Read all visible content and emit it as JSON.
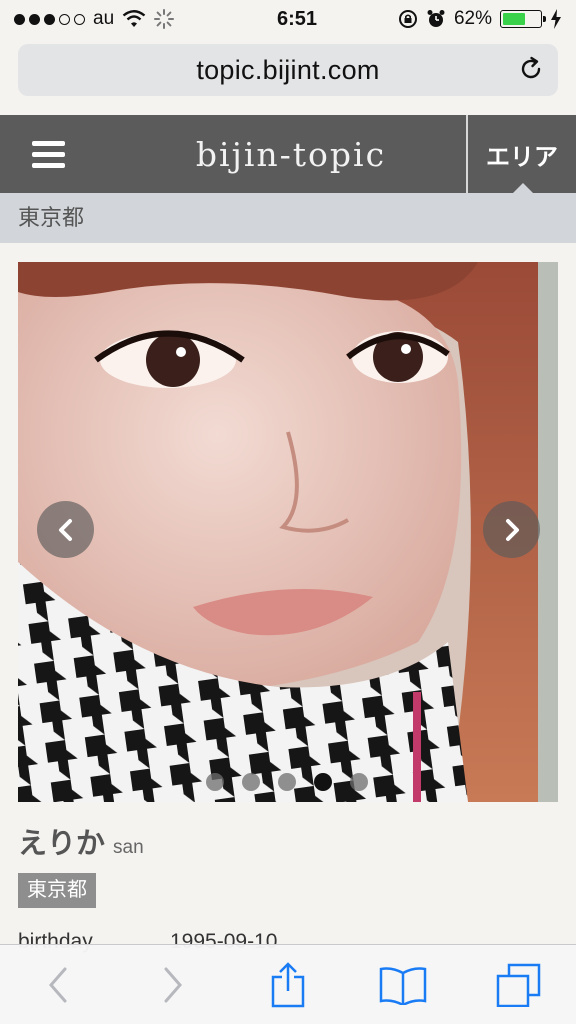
{
  "status_bar": {
    "carrier": "au",
    "time": "6:51",
    "battery_percent": "62%",
    "battery_level": 0.62,
    "icons": [
      "signal-dots",
      "wifi-icon",
      "loading-spinner-icon",
      "rotation-lock-icon",
      "alarm-icon",
      "battery-icon",
      "charging-bolt-icon"
    ]
  },
  "browser": {
    "url": "topic.bijint.com"
  },
  "site": {
    "logo": "bijin-topic",
    "area_button": "エリア",
    "breadcrumb": "東京都"
  },
  "carousel": {
    "slide_count": 5,
    "active_index": 3
  },
  "profile": {
    "name": "えりか",
    "honorific": "san",
    "area_tag": "東京都",
    "birthday_label": "birthday",
    "birthday_value": "1995-09-10"
  },
  "toolbar": {
    "icons": [
      "back-icon",
      "forward-icon",
      "share-icon",
      "bookmarks-icon",
      "tabs-icon"
    ]
  },
  "colors": {
    "header_bg": "#5b5b5b",
    "crumb_bg": "#d2d6da",
    "ios_blue": "#1a7cf5",
    "tag_bg": "#8e8e8e"
  }
}
